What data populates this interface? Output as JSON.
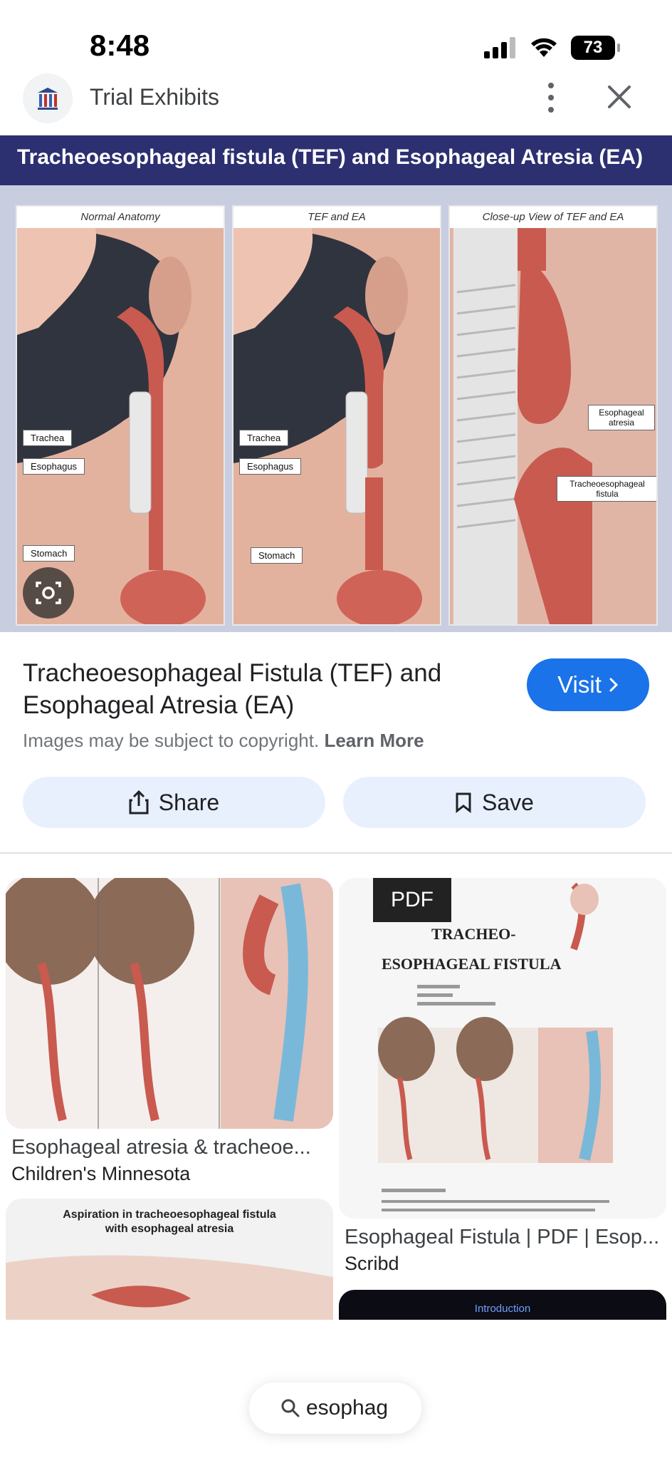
{
  "status_bar": {
    "time": "8:48",
    "battery": "73"
  },
  "header": {
    "site_name": "Trial Exhibits"
  },
  "hero": {
    "banner_title": "Tracheoesophageal fistula (TEF) and Esophageal Atresia (EA)",
    "panels": [
      {
        "heading": "Normal Anatomy",
        "labels": [
          "Trachea",
          "Esophagus",
          "Stomach"
        ]
      },
      {
        "heading": "TEF and EA",
        "labels": [
          "Trachea",
          "Esophagus",
          "Stomach"
        ]
      },
      {
        "heading": "Close-up View of TEF and EA",
        "labels": [
          "Esophageal atresia",
          "Tracheoesophageal fistula"
        ]
      }
    ]
  },
  "result": {
    "title": "Tracheoesophageal Fistula (TEF) and Esophageal Atresia (EA)",
    "visit_label": "Visit",
    "copyright_text": "Images may be subject to copyright.",
    "learn_more": "Learn More",
    "share_label": "Share",
    "save_label": "Save"
  },
  "related": [
    {
      "title": "Esophageal atresia & tracheoe...",
      "source": "Children's Minnesota"
    },
    {
      "badge": "PDF",
      "doc_title_line1": "TRACHEO-",
      "doc_title_line2": "ESOPHAGEAL FISTULA",
      "title": "Esophageal Fistula | PDF | Esop...",
      "source": "Scribd"
    },
    {
      "caption_line1": "Aspiration in tracheoesophageal fistula",
      "caption_line2": "with esophageal atresia"
    },
    {
      "caption": "Introduction"
    }
  ],
  "search": {
    "query": "esophag"
  },
  "colors": {
    "accent": "#1a73e8",
    "pill_bg": "#e8f0fe",
    "banner": "#2c2f70"
  }
}
